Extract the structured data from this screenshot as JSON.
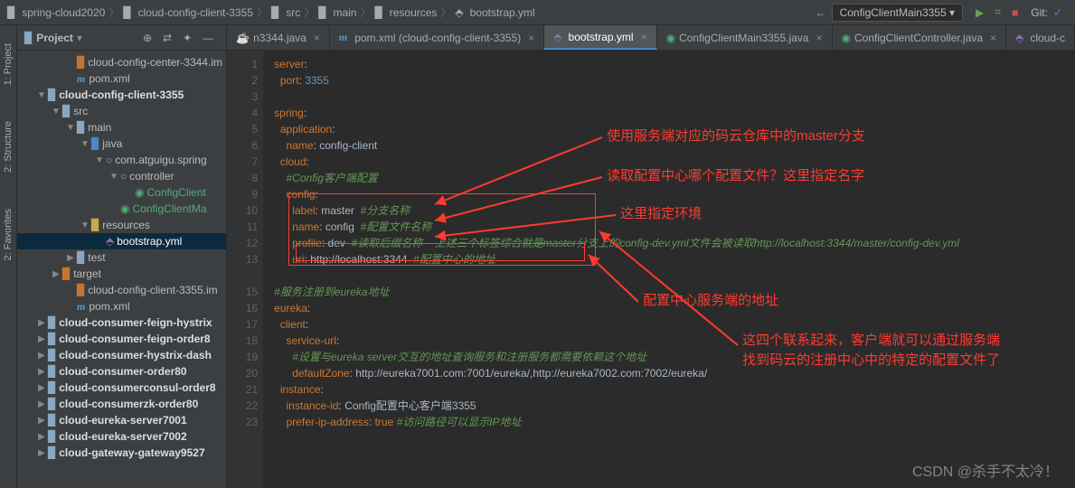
{
  "breadcrumb": [
    "spring-cloud2020",
    "cloud-config-client-3355",
    "src",
    "main",
    "resources",
    "bootstrap.yml"
  ],
  "runConfig": "ConfigClientMain3355",
  "gitLabel": "Git:",
  "panel": {
    "title": "Project"
  },
  "sideTabs": [
    "1: Project",
    "2: Structure",
    "2: Favorites"
  ],
  "tree": {
    "n0": "cloud-config-center-3344.im",
    "n1": "pom.xml",
    "n2": "cloud-config-client-3355",
    "n3": "src",
    "n4": "main",
    "n5": "java",
    "n6": "com.atguigu.spring",
    "n7": "controller",
    "n8": "ConfigClient",
    "n9": "ConfigClientMa",
    "n10": "resources",
    "n11": "bootstrap.yml",
    "n12": "test",
    "n13": "target",
    "n14": "cloud-config-client-3355.im",
    "n15": "pom.xml",
    "n16": "cloud-consumer-feign-hystrix",
    "n17": "cloud-consumer-feign-order8",
    "n18": "cloud-consumer-hystrix-dash",
    "n19": "cloud-consumer-order80",
    "n20": "cloud-consumerconsul-order8",
    "n21": "cloud-consumerzk-order80",
    "n22": "cloud-eureka-server7001",
    "n23": "cloud-eureka-server7002",
    "n24": "cloud-gateway-gateway9527"
  },
  "tabs": [
    {
      "label": "n3344.java",
      "icon": "java"
    },
    {
      "label": "pom.xml (cloud-config-client-3355)",
      "icon": "m"
    },
    {
      "label": "bootstrap.yml",
      "icon": "yml",
      "active": true
    },
    {
      "label": "ConfigClientMain3355.java",
      "icon": "java"
    },
    {
      "label": "ConfigClientController.java",
      "icon": "java"
    },
    {
      "label": "cloud-c",
      "icon": "yml"
    }
  ],
  "code": {
    "l1": "server:",
    "l2": "  port: 3355",
    "l3": "",
    "l4": "spring:",
    "l5": "  application:",
    "l6": "    name: config-client",
    "l7": "  cloud:",
    "l8": "    #Config客户端配置",
    "l9": "    config:",
    "l10": "      label: master  #分支名称",
    "l11": "      name: config  #配置文件名称",
    "l12": "      profile: dev  #读取后缀名称    上述三个标签综合就是master分支上的config-dev.yml文件会被读取http://localhost:3344/master/config-dev.yml",
    "l13": "      uri: http://localhost:3344  #配置中心的地址",
    "l14": "",
    "l15": "#服务注册到eureka地址",
    "l16": "eureka:",
    "l17": "  client:",
    "l18": "    service-url:",
    "l19": "      #设置与eureka server交互的地址查询服务和注册服务都需要依赖这个地址",
    "l20": "      defaultZone: http://eureka7001.com:7001/eureka/,http://eureka7002.com:7002/eureka/",
    "l21": "  instance:",
    "l22": "    instance-id: Config配置中心客户端3355",
    "l23": "    prefer-ip-address: true #访问路径可以显示IP地址"
  },
  "annotations": {
    "a1": "使用服务端对应的码云仓库中的master分支",
    "a2": "读取配置中心哪个配置文件？这里指定名字",
    "a3": "这里指定环境",
    "a4": "配置中心服务端的地址",
    "a5": "这四个联系起来，客户端就可以通过服务端",
    "a5b": "找到码云的注册中心中的特定的配置文件了"
  },
  "watermark": "CSDN @杀手不太冷！"
}
